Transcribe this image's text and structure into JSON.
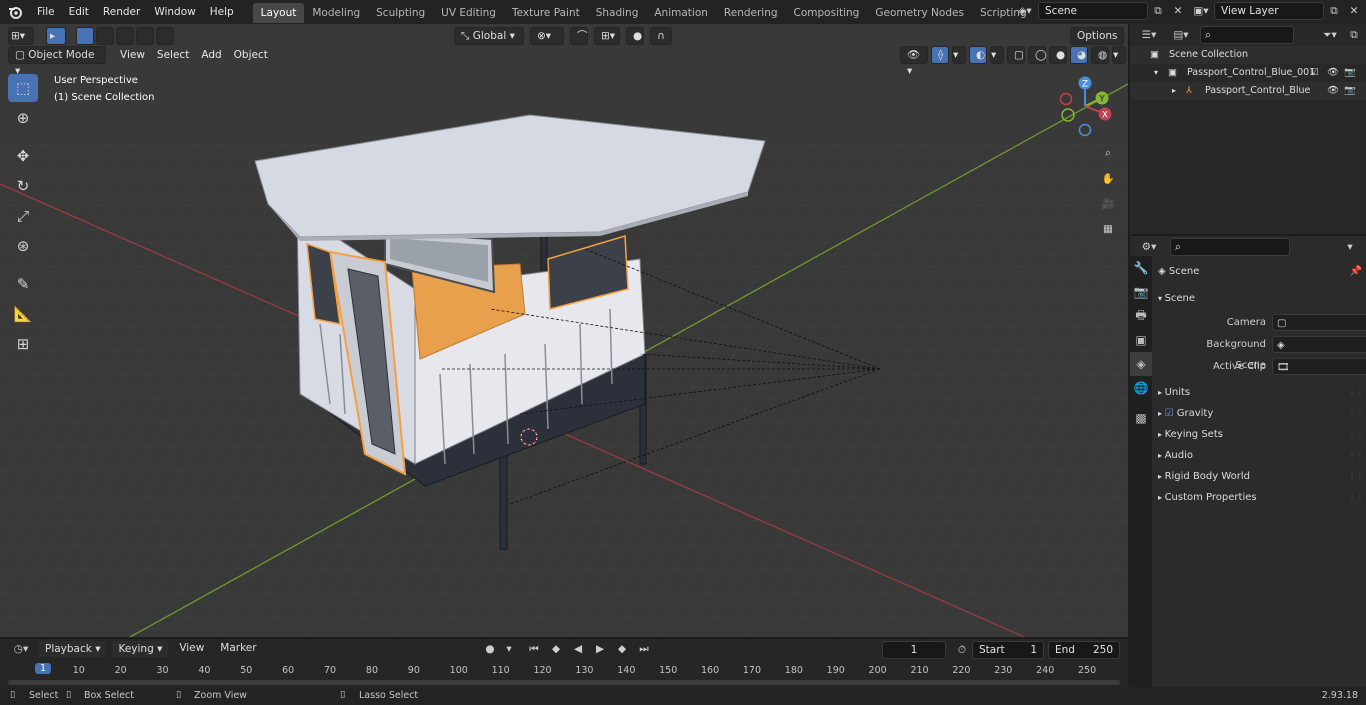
{
  "top_menu": [
    "File",
    "Edit",
    "Render",
    "Window",
    "Help"
  ],
  "workspaces": [
    {
      "label": "Layout",
      "active": true
    },
    {
      "label": "Modeling",
      "active": false
    },
    {
      "label": "Sculpting",
      "active": false
    },
    {
      "label": "UV Editing",
      "active": false
    },
    {
      "label": "Texture Paint",
      "active": false
    },
    {
      "label": "Shading",
      "active": false
    },
    {
      "label": "Animation",
      "active": false
    },
    {
      "label": "Rendering",
      "active": false
    },
    {
      "label": "Compositing",
      "active": false
    },
    {
      "label": "Geometry Nodes",
      "active": false
    },
    {
      "label": "Scripting",
      "active": false
    }
  ],
  "add_workspace": "+",
  "scene_name": "Scene",
  "view_layer": "View Layer",
  "viewport": {
    "transform_orientation": "Global",
    "options_label": "Options",
    "mode": "Object Mode",
    "menus": [
      "View",
      "Select",
      "Add",
      "Object"
    ],
    "perspective_label": "User Perspective",
    "collection_label": "(1) Scene Collection",
    "gizmo": {
      "z": "Z",
      "y": "Y",
      "x": "X"
    }
  },
  "outliner": {
    "root": "Scene Collection",
    "collection": "Passport_Control_Blue_001",
    "object": "Passport_Control_Blue"
  },
  "properties": {
    "scene_title": "Scene",
    "panel_title": "Scene",
    "camera_label": "Camera",
    "background_scene_label": "Background Scene",
    "active_clip_label": "Active Clip",
    "subpanels": [
      "Units",
      "Gravity",
      "Keying Sets",
      "Audio",
      "Rigid Body World",
      "Custom Properties"
    ],
    "gravity_checked": true
  },
  "timeline": {
    "menus": [
      "Playback",
      "Keying",
      "View",
      "Marker"
    ],
    "current_frame": "1",
    "start_label": "Start",
    "start_value": "1",
    "end_label": "End",
    "end_value": "250",
    "ruler": [
      "1",
      "10",
      "20",
      "30",
      "40",
      "50",
      "60",
      "70",
      "80",
      "90",
      "100",
      "110",
      "120",
      "130",
      "140",
      "150",
      "160",
      "170",
      "180",
      "190",
      "200",
      "210",
      "220",
      "230",
      "240",
      "250"
    ]
  },
  "statusbar": {
    "select": "Select",
    "box_select": "Box Select",
    "zoom_view": "Zoom View",
    "lasso_select": "Lasso Select",
    "version": "2.93.18"
  },
  "colors": {
    "accent": "#4772b3",
    "selection_orange": "#f5a040",
    "x_axis": "#c0424c",
    "y_axis": "#86b733",
    "z_axis": "#4a8fdc"
  }
}
